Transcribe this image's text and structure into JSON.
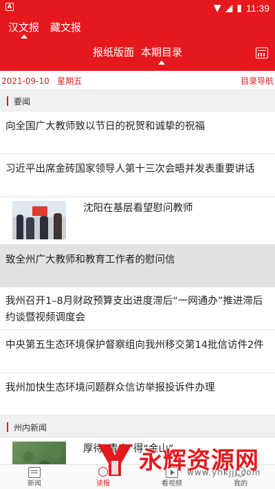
{
  "status_bar": {
    "time": "11:39",
    "icons": [
      "app-notification-icon",
      "wifi-icon",
      "signal-icon",
      "battery-icon"
    ]
  },
  "header": {
    "language_tabs": [
      {
        "label": "汉文报",
        "selected": true
      },
      {
        "label": "藏文报",
        "selected": false
      }
    ],
    "paper_tabs": [
      {
        "label": "报纸版面",
        "selected": false
      },
      {
        "label": "本期目录",
        "selected": true
      }
    ],
    "layout_icon": "layout-grid-icon"
  },
  "date_row": {
    "date": "2021-09-10",
    "weekday": "星期五",
    "nav_label": "目录导航"
  },
  "sections": [
    {
      "label": "要闻",
      "items": [
        {
          "title": "向全国广大教师致以节日的祝贺和诚挚的祝福"
        },
        {
          "title": "习近平出席金砖国家领导人第十三次会晤并发表重要讲话"
        },
        {
          "title": "沈阳在基层看望慰问教师",
          "thumb": "classroom-meeting-photo"
        },
        {
          "title": "致全州广大教师和教育工作者的慰问信",
          "highlighted": true
        },
        {
          "title": "我州召开1–8月财政预算支出进度滞后“一网通办”推进滞后约谈暨视频调度会"
        },
        {
          "title": "中央第五生态环境保护督察组向我州移交第14批信访件2件"
        },
        {
          "title": "我州加快生态环境问题群众信访举报投诉件办理"
        }
      ]
    },
    {
      "label": "州内新闻",
      "items": [
        {
          "title": "厚待“青山”得“金山”",
          "thumb": "forest-aerial-photo"
        }
      ]
    }
  ],
  "tab_bar": [
    {
      "label": "新闻",
      "icon": "newspaper-icon",
      "active": false
    },
    {
      "label": "读报",
      "icon": "reader-icon",
      "active": true
    },
    {
      "label": "看视频",
      "icon": "video-icon",
      "active": false
    },
    {
      "label": "我的",
      "icon": "profile-icon",
      "active": false
    }
  ],
  "watermark": {
    "brand": "永辉资源网",
    "url": "www.yhkjjj.com"
  },
  "colors": {
    "accent": "#e5181d",
    "section_bg": "#f0f0f0",
    "highlight_bg": "#e2e2e2"
  }
}
